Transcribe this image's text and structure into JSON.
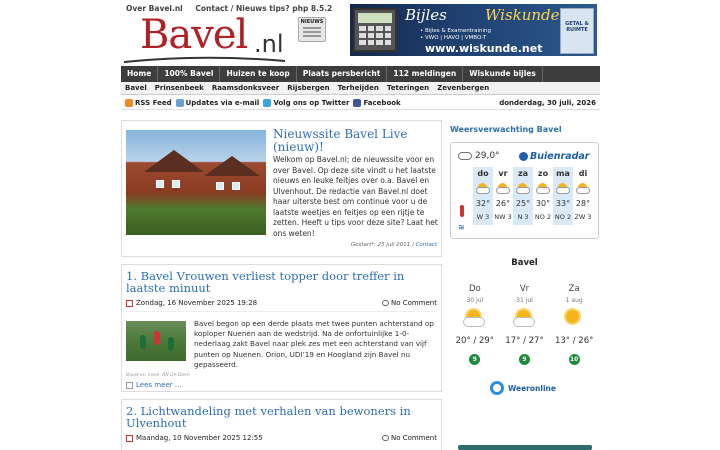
{
  "toplinks": [
    "Over Bavel.nl",
    "Contact / Nieuws tips? php 8.5.2"
  ],
  "logo": {
    "word": "Bavel",
    "tld": ".nl",
    "news_icon_text": "NIEUWS"
  },
  "banner": {
    "title_left": "Bijles",
    "title_right": "Wiskunde",
    "line1": "• Bijles & Examentraining",
    "line2": "• VWO | HAVO | VMBO-T",
    "url": "www.wiskunde.net",
    "book_text": "GETAL & RUIMTE"
  },
  "main_nav": [
    "Home",
    "100% Bavel",
    "Huizen te koop",
    "Plaats persbericht",
    "112 meldingen",
    "Wiskunde bijles"
  ],
  "sub_nav": [
    "Bavel",
    "Prinsenbeek",
    "Raamsdonksveer",
    "Rijsbergen",
    "Terheijden",
    "Teteringen",
    "Zevenbergen"
  ],
  "link_bar": {
    "items": [
      {
        "label": "RSS Feed",
        "color": "#f08a24"
      },
      {
        "label": "Updates via e-mail",
        "color": "#6aa0d8"
      },
      {
        "label": "Volg ons op Twitter",
        "color": "#3aa5e0"
      },
      {
        "label": "Facebook",
        "color": "#3b5998"
      }
    ],
    "date": "donderdag, 30 juli, 2026"
  },
  "featured": {
    "title": "Nieuwssite Bavel Live (nieuw)!",
    "text": "Welkom op Bavel.nl; de nieuwssite voor en over Bavel. Op deze site vindt u het laatste nieuws en leuke feitjes over o.a. Bavel en Ulvenhout. De redactie van Bavel.nl doet haar uiterste best om continue voor u de laatste weetjes en feitjes op een rijtje te zetten. Heeft u tips voor deze site? Laat het ons weten!",
    "meta": "Gestart*: 25 juli 2011 / ",
    "meta_link": "Contact"
  },
  "posts": [
    {
      "title": "1. Bavel Vrouwen verliest topper door treffer in laatste minuut",
      "date": "Zondag, 16 November 2025 19:28",
      "comments": "No Comment",
      "text": "Bavel begon op een derde plaats met twee punten achterstand op koploper Nuenen aan de wedstrijd. Na de onfortuinlijke 1-0-nederlaag zakt Bavel naar plek zes met een achterstand van vijf punten op Nuenen. Orion, UDI’19 en Hoogland zijn Bavel nu gepasseerd.",
      "credit": "Bavel vs. Irene, RN De Diem",
      "more": "Lees meer …"
    },
    {
      "title": "2. Lichtwandeling met verhalen van bewoners in Ulvenhout",
      "date": "Maandag, 10 November 2025 12:55",
      "comments": "No Comment"
    }
  ],
  "weather": {
    "heading": "Weersverwachting Bavel",
    "current": "29,0°",
    "provider": "Buienradar",
    "days": [
      {
        "day": "do",
        "temp": "32°",
        "wind": "W 3",
        "icon": "sun-cloud"
      },
      {
        "day": "vr",
        "temp": "26°",
        "wind": "NW 3",
        "icon": "sun-cloud"
      },
      {
        "day": "za",
        "temp": "25°",
        "wind": "N 3",
        "icon": "sun-cloud"
      },
      {
        "day": "zo",
        "temp": "30°",
        "wind": "NO 2",
        "icon": "sun-cloud"
      },
      {
        "day": "ma",
        "temp": "33°",
        "wind": "NO 2",
        "icon": "sun-cloud"
      },
      {
        "day": "di",
        "temp": "28°",
        "wind": "ZW 3",
        "icon": "sun-cloud"
      }
    ]
  },
  "weeronline": {
    "title": "Bavel",
    "days": [
      {
        "day": "Do",
        "date": "30 jul",
        "temps": "20° / 29°",
        "score": "9",
        "icon": "sun-cloud"
      },
      {
        "day": "Vr",
        "date": "31 jul",
        "temps": "17° / 27°",
        "score": "9",
        "icon": "sun-cloud"
      },
      {
        "day": "Za",
        "date": "1 aug",
        "temps": "13° / 26°",
        "score": "10",
        "icon": "sun"
      }
    ],
    "brand": "Weeronline"
  }
}
